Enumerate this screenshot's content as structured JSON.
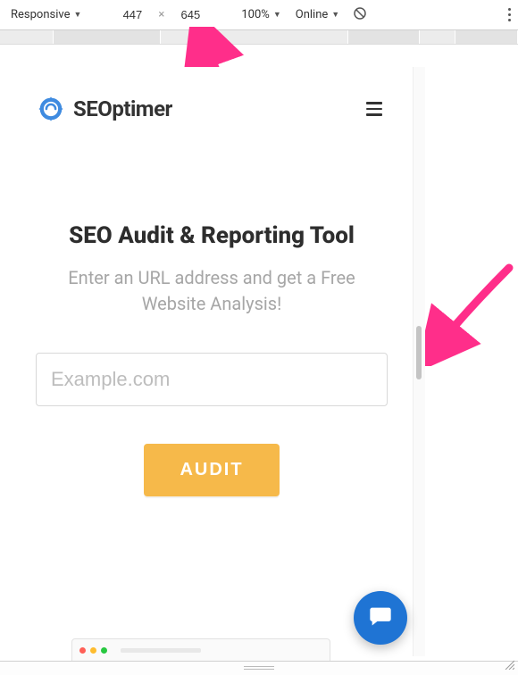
{
  "toolbar": {
    "device_mode": "Responsive",
    "width": "447",
    "height": "645",
    "zoom": "100%",
    "throttle": "Online"
  },
  "page": {
    "brand": "SEOptimer",
    "headline": "SEO Audit & Reporting Tool",
    "subhead": "Enter an URL address and get a Free Website Analysis!",
    "url_placeholder": "Example.com",
    "cta": "AUDIT"
  },
  "colors": {
    "accent_blue": "#3f8be0",
    "cta_yellow": "#f6b94a",
    "chat_blue": "#1f74d4",
    "annotation_pink": "#ff2e8a"
  }
}
